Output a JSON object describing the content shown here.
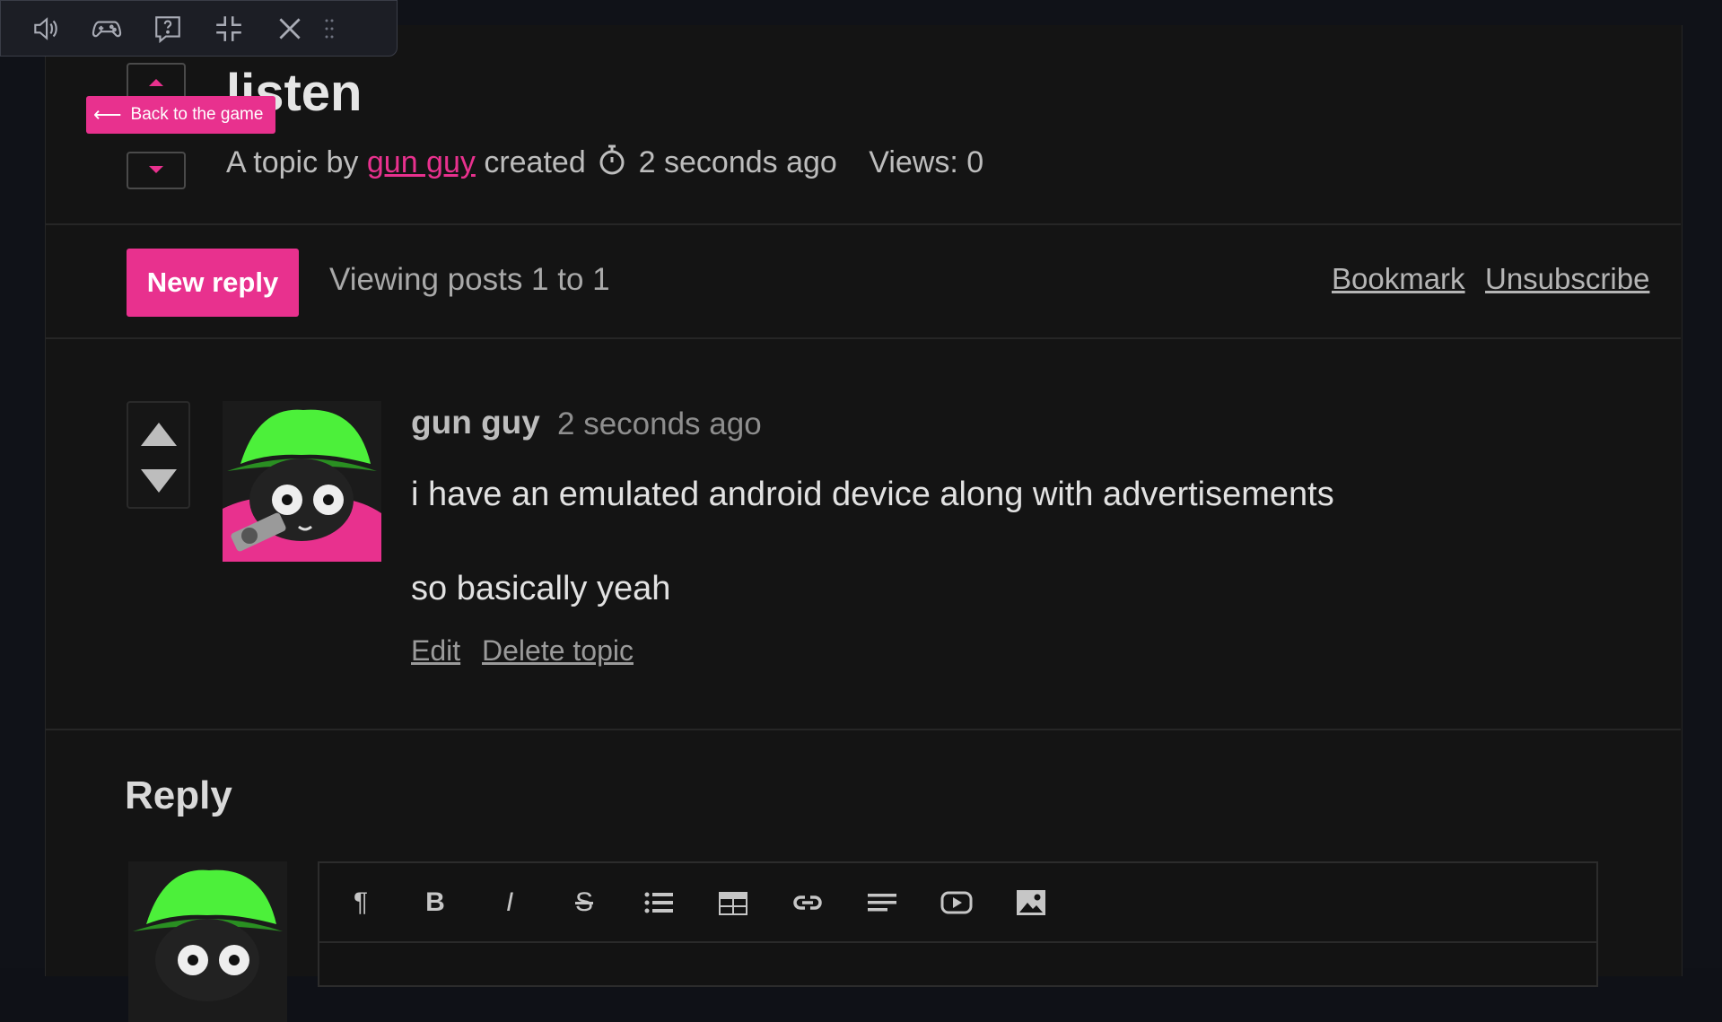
{
  "overlay": {
    "buttons": [
      {
        "name": "volume-icon"
      },
      {
        "name": "gamepad-icon"
      },
      {
        "name": "help-icon"
      },
      {
        "name": "exit-fullscreen-icon"
      },
      {
        "name": "close-icon"
      }
    ],
    "back_label": "Back to the game"
  },
  "topic": {
    "title": "listen",
    "meta_prefix": "A topic by",
    "author": "gun guy",
    "created_word": "created",
    "created_ago": "2 seconds ago",
    "views": "Views: 0"
  },
  "actions": {
    "new_reply": "New reply",
    "viewing": "Viewing posts 1 to 1",
    "bookmark": "Bookmark",
    "unsubscribe": "Unsubscribe"
  },
  "post": {
    "author": "gun guy",
    "time": "2 seconds ago",
    "lines": [
      "i have an emulated android device along with advertisements",
      "so basically yeah"
    ],
    "edit": "Edit",
    "delete": "Delete topic"
  },
  "reply": {
    "heading": "Reply",
    "toolbar": [
      "paragraph-icon",
      "bold-icon",
      "italic-icon",
      "strikethrough-icon",
      "bullet-list-icon",
      "table-icon",
      "link-icon",
      "align-icon",
      "video-embed-icon",
      "image-icon"
    ]
  },
  "colors": {
    "accent": "#e8318e",
    "background": "#141414",
    "avatar_hat": "#4cf03a",
    "avatar_shirt": "#e8318e"
  }
}
